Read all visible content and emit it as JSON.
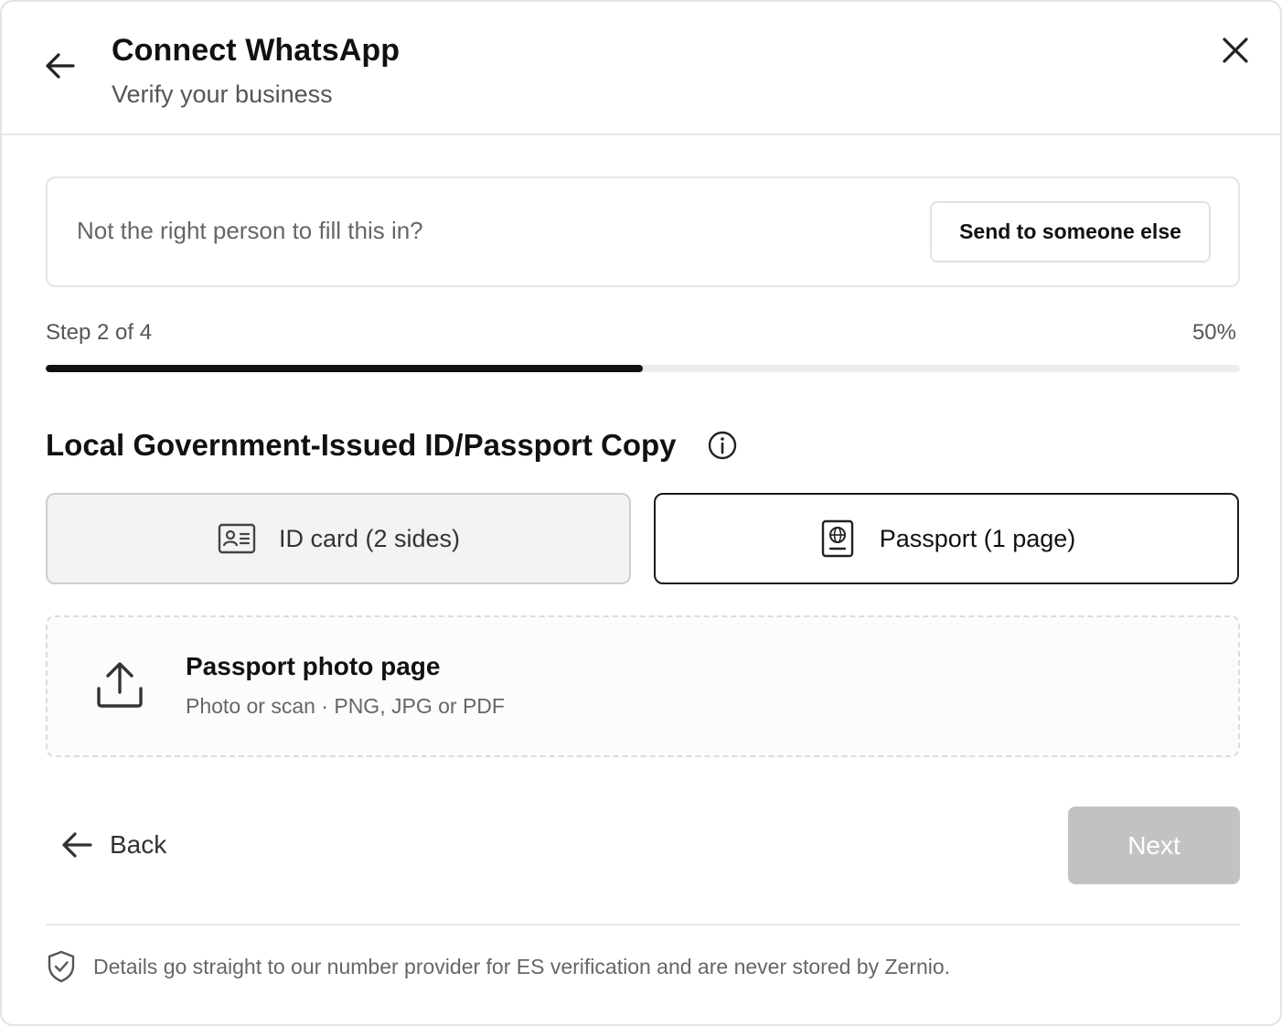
{
  "header": {
    "title": "Connect WhatsApp",
    "subtitle": "Verify your business",
    "back_icon": "arrow-left-icon",
    "close_icon": "close-icon"
  },
  "delegate": {
    "prompt": "Not the right person to fill this in?",
    "send_button_label": "Send to someone else"
  },
  "progress": {
    "step_label": "Step 2 of 4",
    "percent_label": "50%",
    "fraction": 0.5
  },
  "document": {
    "section_title": "Local Government-Issued ID/Passport Copy",
    "info_icon": "info-icon",
    "options": [
      {
        "label": "ID card (2 sides)",
        "icon": "id-card-icon",
        "selected": false
      },
      {
        "label": "Passport (1 page)",
        "icon": "passport-icon",
        "selected": true
      }
    ]
  },
  "upload": {
    "icon": "upload-icon",
    "title": "Passport photo page",
    "hint": "Photo or scan · PNG, JPG or PDF"
  },
  "footer": {
    "back_label": "Back",
    "next_label": "Next",
    "next_enabled": false,
    "privacy_icon": "shield-icon",
    "privacy_text": "Details go straight to our number provider for ES verification and are never stored by Zernio."
  },
  "colors": {
    "accent": "#111111",
    "disabled_button": "#c2c2c2",
    "selected_option_border": "#1a1a1a",
    "unselected_option_bg": "#f3f3f3"
  }
}
